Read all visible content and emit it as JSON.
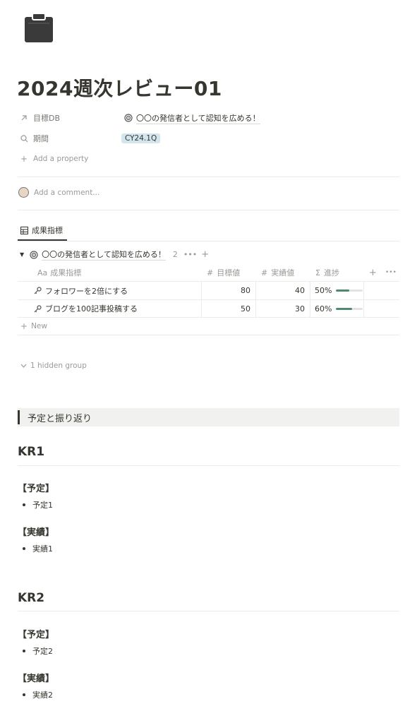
{
  "page": {
    "title": "2024週次レビュー01",
    "icon": "clipboard-icon"
  },
  "properties": [
    {
      "icon": "arrow-up-right-icon",
      "label": "目標DB",
      "value": "〇〇の発信者として認知を広める！",
      "value_icon": "target-icon"
    },
    {
      "icon": "search-icon",
      "label": "期間",
      "value": "CY24.1Q"
    }
  ],
  "add_property": "Add a property",
  "comment_placeholder": "Add a comment...",
  "db": {
    "tab_label": "成果指標",
    "group_label": "〇〇の発信者として認知を広める！",
    "group_count": "2",
    "columns": {
      "name": "成果指標",
      "name_prefix": "Aa",
      "target": "目標値",
      "actual": "実績値",
      "progress": "進捗"
    },
    "rows": [
      {
        "name": "フォロワーを2倍にする",
        "target": "80",
        "actual": "40",
        "progress_label": "50%",
        "progress": 0.5
      },
      {
        "name": "ブログを100記事投稿する",
        "target": "50",
        "actual": "30",
        "progress_label": "60%",
        "progress": 0.6
      }
    ],
    "new_label": "New",
    "hidden_group": "1 hidden group"
  },
  "callout": "予定と振り返り",
  "sections": [
    {
      "title": "KR1",
      "plan_head": "【予定】",
      "plan_item": "予定1",
      "result_head": "【実績】",
      "result_item": "実績1"
    },
    {
      "title": "KR2",
      "plan_head": "【予定】",
      "plan_item": "予定2",
      "result_head": "【実績】",
      "result_item": "実績2"
    }
  ],
  "colors": {
    "text": "#37352f",
    "muted": "#9b9a97",
    "tag_bg": "#d3e5ef",
    "progress": "#4e8a6e",
    "callout_bg": "#f1f1ef"
  }
}
